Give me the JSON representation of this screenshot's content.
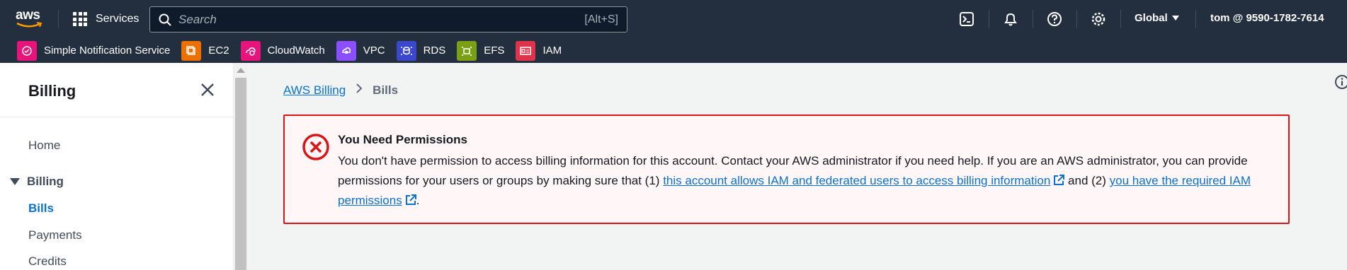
{
  "topbar": {
    "logo": "aws",
    "services_label": "Services",
    "search_placeholder": "Search",
    "search_shortcut": "[Alt+S]",
    "region": "Global",
    "account": "tom @ 9590-1782-7614",
    "icons": [
      "cloudshell-icon",
      "notifications-icon",
      "help-icon",
      "settings-icon"
    ]
  },
  "favorites": [
    {
      "label": "Simple Notification Service",
      "color": "#e7157b"
    },
    {
      "label": "EC2",
      "color": "#ed7100"
    },
    {
      "label": "CloudWatch",
      "color": "#e7157b"
    },
    {
      "label": "VPC",
      "color": "#8c4fff"
    },
    {
      "label": "RDS",
      "color": "#3b48cc"
    },
    {
      "label": "EFS",
      "color": "#7aa116"
    },
    {
      "label": "IAM",
      "color": "#dd344c"
    }
  ],
  "sidenav": {
    "title": "Billing",
    "home": "Home",
    "section": "Billing",
    "items": [
      "Bills",
      "Payments",
      "Credits"
    ]
  },
  "breadcrumb": {
    "parent": "AWS Billing",
    "current": "Bills"
  },
  "alert": {
    "title": "You Need Permissions",
    "text_1": "You don't have permission to access billing information for this account. Contact your AWS administrator if you need help. If you are an AWS administrator, you can provide permissions for your users or groups by making sure that (1) ",
    "link_1": "this account allows IAM and federated users to access billing information",
    "text_2": " and (2) ",
    "link_2": "you have the required IAM permissions",
    "text_3": "."
  },
  "colors": {
    "nav_bg": "#232f3e",
    "link": "#0972d3",
    "error": "#d91515",
    "error_bg": "#fff7f7"
  }
}
